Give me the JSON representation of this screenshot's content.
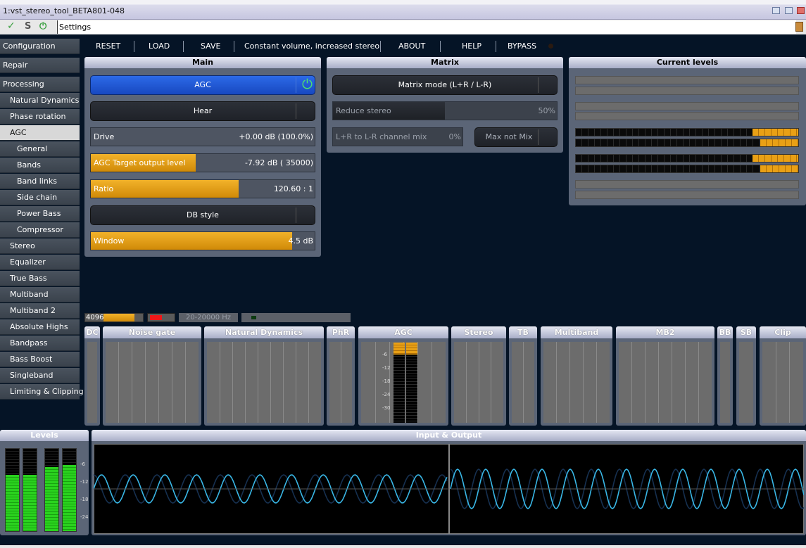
{
  "window": {
    "title": "1:vst_stereo_tool_BETA801-048"
  },
  "address_bar": {
    "value": "Settings",
    "icons": [
      "check-icon",
      "s-icon",
      "power-icon",
      "cabinet-icon"
    ]
  },
  "sidebar": {
    "items": [
      {
        "label": "Configuration",
        "level": 0,
        "selected": false
      },
      {
        "label": "Repair",
        "level": 0,
        "selected": false
      },
      {
        "label": "Processing",
        "level": 0,
        "selected": false
      },
      {
        "label": "Natural Dynamics",
        "level": 1,
        "selected": false
      },
      {
        "label": "Phase rotation",
        "level": 1,
        "selected": false
      },
      {
        "label": "AGC",
        "level": 1,
        "selected": true
      },
      {
        "label": "General",
        "level": 2,
        "selected": false
      },
      {
        "label": "Bands",
        "level": 2,
        "selected": false
      },
      {
        "label": "Band links",
        "level": 2,
        "selected": false
      },
      {
        "label": "Side chain",
        "level": 2,
        "selected": false
      },
      {
        "label": "Power Bass",
        "level": 2,
        "selected": false
      },
      {
        "label": "Compressor",
        "level": 2,
        "selected": false
      },
      {
        "label": "Stereo",
        "level": 1,
        "selected": false
      },
      {
        "label": "Equalizer",
        "level": 1,
        "selected": false
      },
      {
        "label": "True Bass",
        "level": 1,
        "selected": false
      },
      {
        "label": "Multiband",
        "level": 1,
        "selected": false
      },
      {
        "label": "Multiband 2",
        "level": 1,
        "selected": false
      },
      {
        "label": "Absolute Highs",
        "level": 1,
        "selected": false
      },
      {
        "label": "Bandpass",
        "level": 1,
        "selected": false
      },
      {
        "label": "Bass Boost",
        "level": 1,
        "selected": false
      },
      {
        "label": "Singleband",
        "level": 1,
        "selected": false
      },
      {
        "label": "Limiting & Clipping",
        "level": 1,
        "selected": false
      }
    ]
  },
  "toolbar": {
    "reset": "RESET",
    "load": "LOAD",
    "save": "SAVE",
    "preset": "Constant volume, increased stereo",
    "about": "ABOUT",
    "help": "HELP",
    "bypass": "BYPASS"
  },
  "main_panel": {
    "title": "Main",
    "agc_button": "AGC",
    "agc_enabled": true,
    "hear_button": "Hear",
    "drive": {
      "label": "Drive",
      "value": "+0.00 dB (100.0%)",
      "fraction": 0.0
    },
    "target": {
      "label": "AGC Target output level",
      "value": "-7.92 dB ( 35000)",
      "fraction": 0.47
    },
    "ratio": {
      "label": "Ratio",
      "value": "120.60 : 1",
      "fraction": 0.66
    },
    "db_style_button": "DB style",
    "window": {
      "label": "Window",
      "value": "4.5 dB",
      "fraction": 0.9
    }
  },
  "matrix_panel": {
    "title": "Matrix",
    "mode_button": "Matrix mode (L+R / L-R)",
    "reduce_stereo": {
      "label": "Reduce stereo",
      "value": "50%",
      "fraction": 0.5
    },
    "channel_mix": {
      "label": "L+R to L-R channel mix",
      "value": "0%",
      "fraction": 0.0
    },
    "max_not_mix_button": "Max not Mix"
  },
  "levels_panel": {
    "title": "Current levels",
    "led_fractions": [
      0.795,
      0.83,
      0.795,
      0.83
    ]
  },
  "status_row": {
    "block_size": "4096",
    "block_fraction": 0.75,
    "red_fraction": 0.5,
    "freq_range": "20-20000 Hz"
  },
  "modules": [
    {
      "label": "DC"
    },
    {
      "label": "Noise gate"
    },
    {
      "label": "Natural Dynamics"
    },
    {
      "label": "PhR"
    },
    {
      "label": "AGC"
    },
    {
      "label": "Stereo"
    },
    {
      "label": "TB"
    },
    {
      "label": "Multiband"
    },
    {
      "label": "MB2"
    },
    {
      "label": "BB"
    },
    {
      "label": "SB"
    },
    {
      "label": "Clip"
    }
  ],
  "agc_meter": {
    "scale": [
      "-6",
      "-12",
      "-18",
      "-24",
      "-30"
    ],
    "level_fraction": 0.85
  },
  "levels": {
    "title": "Levels",
    "scale": [
      "-6",
      "-12",
      "-18",
      "-24"
    ],
    "fractions": [
      0.68,
      0.68,
      0.78,
      0.8
    ]
  },
  "io": {
    "title": "Input & Output"
  },
  "colors": {
    "accent_orange": "#e9a015",
    "agc_blue": "#1e56d0",
    "meter_green": "#22c41a",
    "wave_cyan": "#39b7e6",
    "background": "#051426"
  }
}
